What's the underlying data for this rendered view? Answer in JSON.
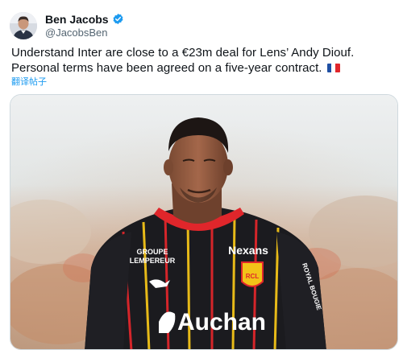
{
  "author": {
    "display_name": "Ben Jacobs",
    "handle": "@JacobsBen",
    "avatar_icon": "profile-photo",
    "verified_icon": "verified-badge-icon",
    "verified_color": "#1d9bf0"
  },
  "tweet": {
    "text": "Understand Inter are close to a €23m deal for Lens’ Andy Diouf. Personal terms have been agreed on a five-year contract.",
    "flag_icon": "france-flag-icon",
    "translate_label": "翻译帖子"
  },
  "media": {
    "image_icon": "player-photo",
    "jersey_texts": {
      "sponsor_left": "GROUPE\nLEMPEREUR",
      "sponsor_right": "Nexans",
      "main_sponsor": "Auchan",
      "crest": "RCL",
      "sleeve": "ROYAL BOUGIE"
    }
  },
  "colors": {
    "text_primary": "#0f1419",
    "text_secondary": "#536471",
    "link": "#1d9bf0",
    "jersey_red": "#e0262b",
    "jersey_yellow": "#f2c318"
  }
}
